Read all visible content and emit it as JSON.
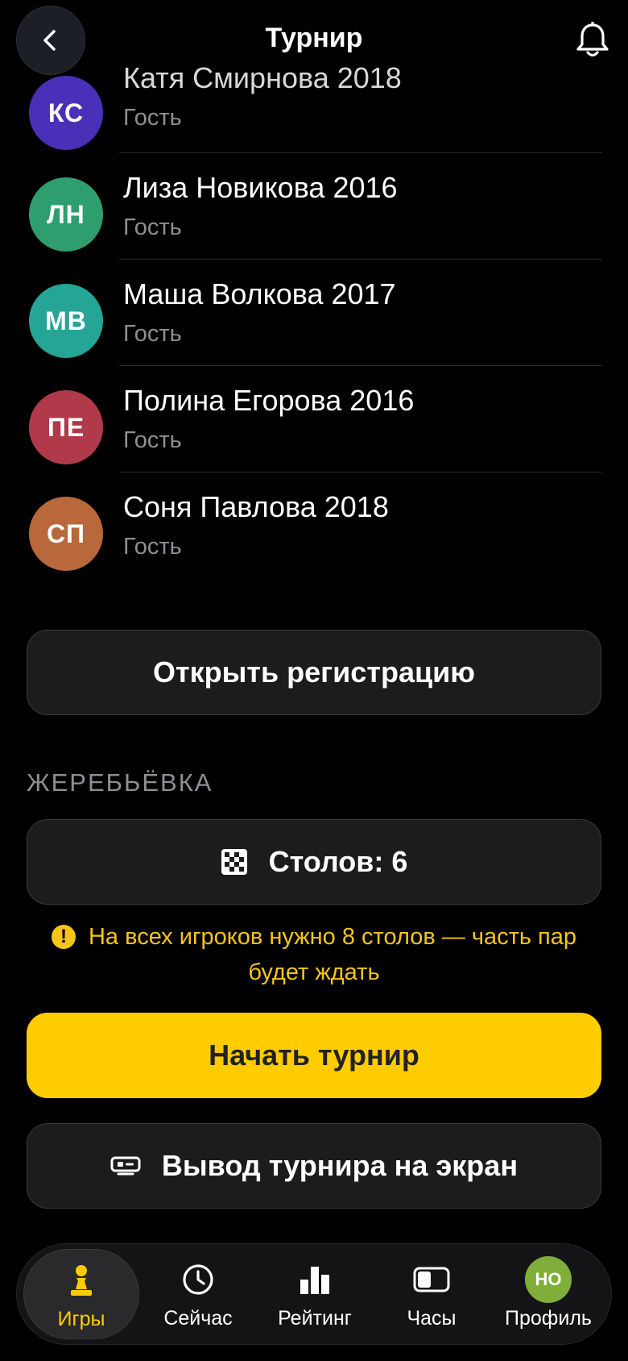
{
  "header": {
    "title": "Турнир",
    "back_icon": "chevron-left-icon",
    "bell_icon": "bell-icon"
  },
  "players": [
    {
      "initials": "КС",
      "name": "Катя Смирнова 2018",
      "role": "Гость",
      "color": "#4a30b8"
    },
    {
      "initials": "ЛН",
      "name": "Лиза Новикова 2016",
      "role": "Гость",
      "color": "#2e9e6e"
    },
    {
      "initials": "МВ",
      "name": "Маша Волкова 2017",
      "role": "Гость",
      "color": "#24a596"
    },
    {
      "initials": "ПЕ",
      "name": "Полина Егорова 2016",
      "role": "Гость",
      "color": "#b03a4a"
    },
    {
      "initials": "СП",
      "name": "Соня Павлова 2018",
      "role": "Гость",
      "color": "#b8683a"
    }
  ],
  "open_registration_label": "Открыть регистрацию",
  "draw": {
    "section_label": "ЖЕРЕБЬЁВКА",
    "tables_label": "Столов: 6",
    "tables_icon": "chessboard-icon",
    "warning": "На всех игроков нужно 8 столов — часть пар будет ждать"
  },
  "start_button_label": "Начать турнир",
  "screen_button_label": "Вывод турнира на экран",
  "colors": {
    "accent": "#ffcc00",
    "background": "#000000"
  },
  "tabs": [
    {
      "label": "Игры",
      "icon": "pawn-icon",
      "active": true
    },
    {
      "label": "Сейчас",
      "icon": "clock-icon",
      "active": false
    },
    {
      "label": "Рейтинг",
      "icon": "bar-chart-icon",
      "active": false
    },
    {
      "label": "Часы",
      "icon": "chess-clock-icon",
      "active": false
    },
    {
      "label": "Профиль",
      "icon": "profile-avatar",
      "initials": "НО",
      "active": false
    }
  ]
}
